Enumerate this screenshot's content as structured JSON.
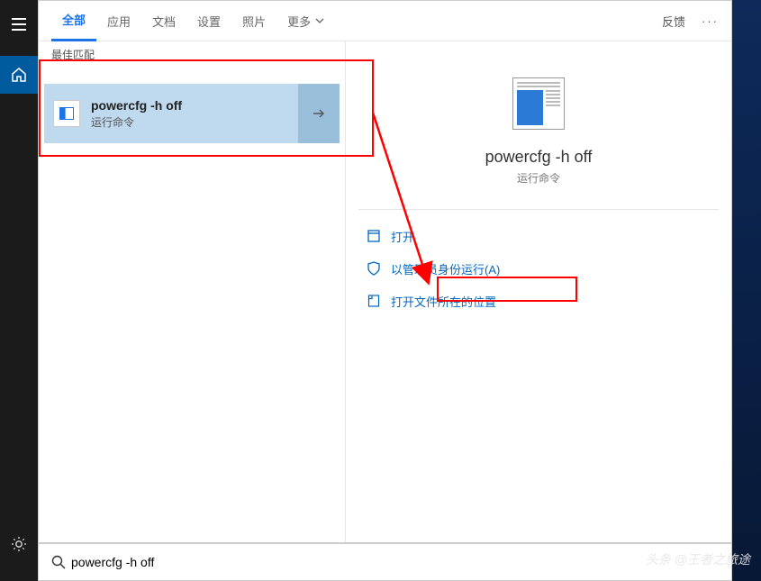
{
  "sidebar": {
    "items": [
      "menu-icon",
      "home-icon",
      "gear-icon"
    ]
  },
  "tabs": {
    "items": [
      {
        "label": "全部",
        "active": true
      },
      {
        "label": "应用",
        "active": false
      },
      {
        "label": "文档",
        "active": false
      },
      {
        "label": "设置",
        "active": false
      },
      {
        "label": "照片",
        "active": false
      },
      {
        "label": "更多",
        "active": false
      }
    ],
    "feedback": "反馈"
  },
  "left": {
    "best_match_label": "最佳匹配",
    "result": {
      "title": "powercfg -h off",
      "subtitle": "运行命令"
    }
  },
  "right": {
    "title": "powercfg -h off",
    "subtitle": "运行命令",
    "actions": [
      {
        "icon": "open-icon",
        "label": "打开"
      },
      {
        "icon": "shield-icon",
        "label": "以管理员身份运行(A)"
      },
      {
        "icon": "folder-icon",
        "label": "打开文件所在的位置"
      }
    ]
  },
  "search": {
    "value": "powercfg -h off"
  },
  "watermark": "头条 @王者之旅途"
}
